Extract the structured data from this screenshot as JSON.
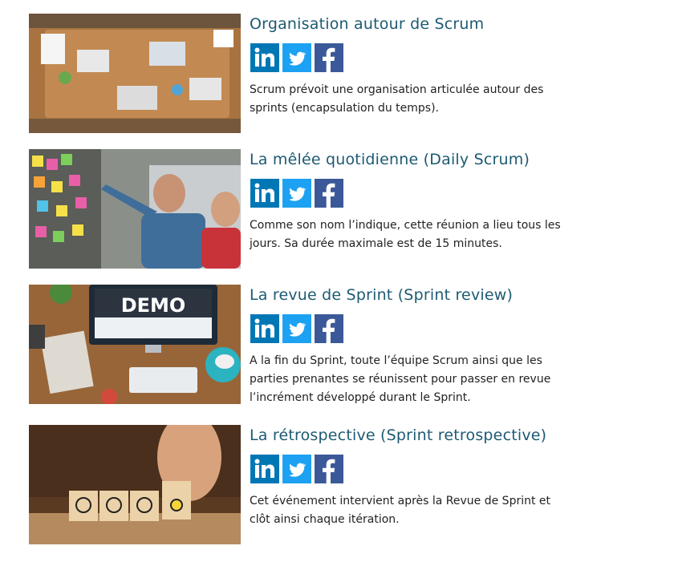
{
  "articles": [
    {
      "title": "Organisation autour de Scrum",
      "description": "Scrum prévoit une organisation articulée autour des sprints (encapsulation du temps).",
      "image": "team-meeting-table-photo"
    },
    {
      "title": "La mêlée quotidienne (Daily Scrum)",
      "description": "Comme son nom l’indique, cette réunion a lieu tous les jours. Sa durée maximale est de 15 minutes.",
      "image": "sticky-notes-wall-photo"
    },
    {
      "title": "La revue de Sprint (Sprint review)",
      "description": "A la fin du Sprint, toute l’équipe Scrum ainsi que les parties prenantes se réunissent pour passer en revue l’incrément développé durant le Sprint.",
      "image": "demo-desk-photo",
      "image_text": "DEMO"
    },
    {
      "title": "La rétrospective (Sprint retrospective)",
      "description": "Cet événement intervient après la Revue de Sprint et clôt ainsi chaque itération.",
      "image": "wooden-cubes-photo"
    }
  ],
  "share_icons": [
    "linkedin-icon",
    "twitter-icon",
    "facebook-icon"
  ],
  "colors": {
    "title": "#1d5a73",
    "linkedin": "#0077b5",
    "twitter": "#1da1f2",
    "facebook": "#3b5998"
  }
}
